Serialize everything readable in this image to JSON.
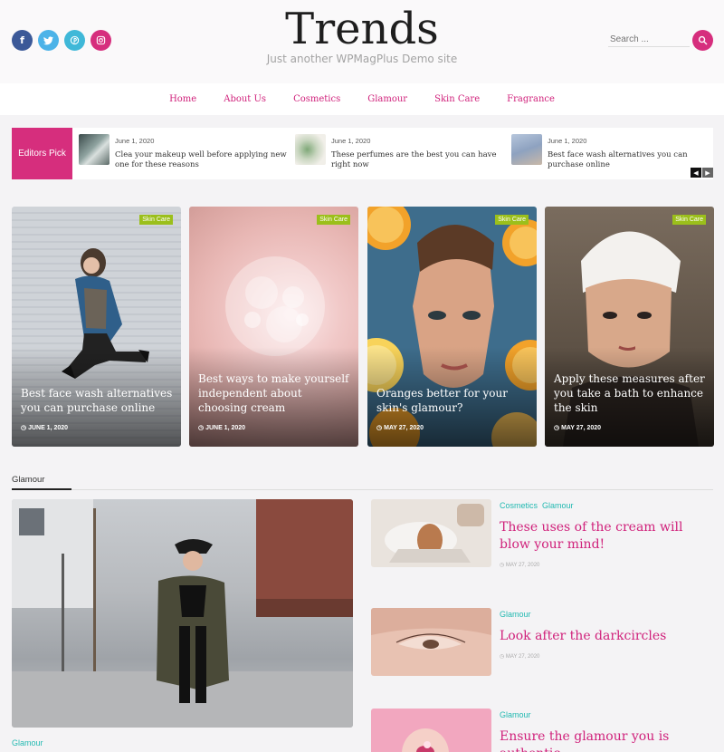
{
  "header": {
    "title": "Trends",
    "tagline": "Just another WPMagPlus Demo site",
    "search_placeholder": "Search ...",
    "social": [
      {
        "name": "facebook-icon",
        "glyph": "f",
        "color": "#3b5998"
      },
      {
        "name": "twitter-icon",
        "glyph": "t",
        "color": "#4cb3e8"
      },
      {
        "name": "pinterest-icon",
        "glyph": "p",
        "color": "#3fb8d8"
      },
      {
        "name": "instagram-icon",
        "glyph": "◎",
        "color": "#d62e7d"
      }
    ]
  },
  "nav": {
    "items": [
      {
        "label": "Home"
      },
      {
        "label": "About Us"
      },
      {
        "label": "Cosmetics"
      },
      {
        "label": "Glamour"
      },
      {
        "label": "Skin Care"
      },
      {
        "label": "Fragrance"
      }
    ]
  },
  "ticker": {
    "label": "Editors Pick",
    "items": [
      {
        "date": "June 1, 2020",
        "title": "Clea your makeup well before applying new one for these reasons"
      },
      {
        "date": "June 1, 2020",
        "title": "These perfumes are the best you can have right now"
      },
      {
        "date": "June 1, 2020",
        "title": "Best face wash alternatives you can purchase online"
      }
    ],
    "prev": "◀",
    "next": "▶"
  },
  "cards": [
    {
      "tag": "Skin Care",
      "title": "Best face wash alternatives you can purchase online",
      "date": "JUNE 1, 2020"
    },
    {
      "tag": "Skin Care",
      "title": "Best ways to make yourself independent about choosing cream",
      "date": "JUNE 1, 2020"
    },
    {
      "tag": "Skin Care",
      "title": "Oranges better for your skin's glamour?",
      "date": "MAY 27, 2020"
    },
    {
      "tag": "Skin Care",
      "title": "Apply these measures after you take a bath to enhance the skin",
      "date": "MAY 27, 2020"
    }
  ],
  "glamour": {
    "section_title": "Glamour",
    "big_category": "Glamour",
    "side_posts": [
      {
        "categories": [
          "Cosmetics",
          "Glamour"
        ],
        "title": "These uses of the cream will blow your mind!",
        "date": "MAY 27, 2020"
      },
      {
        "categories": [
          "Glamour"
        ],
        "title": "Look after the darkcircles",
        "date": "MAY 27, 2020"
      },
      {
        "categories": [
          "Glamour"
        ],
        "title": "Ensure the glamour you is authentic"
      }
    ]
  }
}
